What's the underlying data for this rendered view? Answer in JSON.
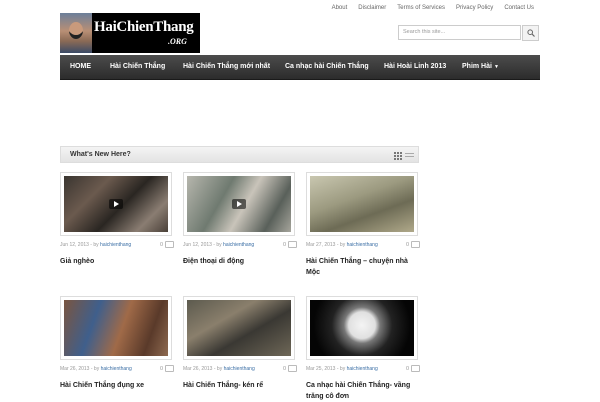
{
  "top_links": [
    "About",
    "Disclaimer",
    "Terms of Services",
    "Privacy Policy",
    "Contact Us"
  ],
  "logo": {
    "name": "HaiChienThang",
    "suffix": ".ORG"
  },
  "search": {
    "placeholder": "Search this site..."
  },
  "nav": {
    "items": [
      "HOME",
      "Hài Chiến Thắng",
      "Hài Chiến Thắng mới nhất",
      "Ca nhạc hài Chiến Thắng",
      "Hài Hoài Linh 2013",
      "Phim Hài"
    ],
    "dropdown_caret": "▼"
  },
  "section": {
    "title": "What's New Here?"
  },
  "posts": [
    {
      "date": "Jun 12, 2013",
      "by": " - by ",
      "author": "haichienthang",
      "comments": "0",
      "title": "Giả nghèo",
      "video": true,
      "thumb_icon": "two-men-talking-scene"
    },
    {
      "date": "Jun 12, 2013",
      "by": " - by ",
      "author": "haichienthang",
      "comments": "0",
      "title": "Điện thoại di động",
      "video": true,
      "thumb_icon": "men-outdoor-scene"
    },
    {
      "date": "Mar 27, 2013",
      "by": " - by ",
      "author": "haichienthang",
      "comments": "0",
      "title": "Hài Chiến Thắng – chuyện nhà Mộc",
      "video": false,
      "thumb_icon": "street-bicycle-scene"
    },
    {
      "date": "Mar 26, 2013",
      "by": " - by ",
      "author": "haichienthang",
      "comments": "0",
      "title": "Hài Chiến Thắng đụng xe",
      "video": false,
      "thumb_icon": "two-men-street-scene"
    },
    {
      "date": "Mar 26, 2013",
      "by": " - by ",
      "author": "haichienthang",
      "comments": "0",
      "title": "Hài Chiến Thắng- kén rể",
      "video": false,
      "thumb_icon": "man-with-hat-scene"
    },
    {
      "date": "Mar 25, 2013",
      "by": " - by ",
      "author": "haichienthang",
      "comments": "0",
      "title": "Ca nhạc hài Chiến Thắng- vầng trăng cô đơn",
      "video": false,
      "thumb_icon": "full-moon-couple-scene"
    }
  ],
  "colors": {
    "nav_bg": "#3a3a3a",
    "author_link": "#3a6ea5"
  }
}
